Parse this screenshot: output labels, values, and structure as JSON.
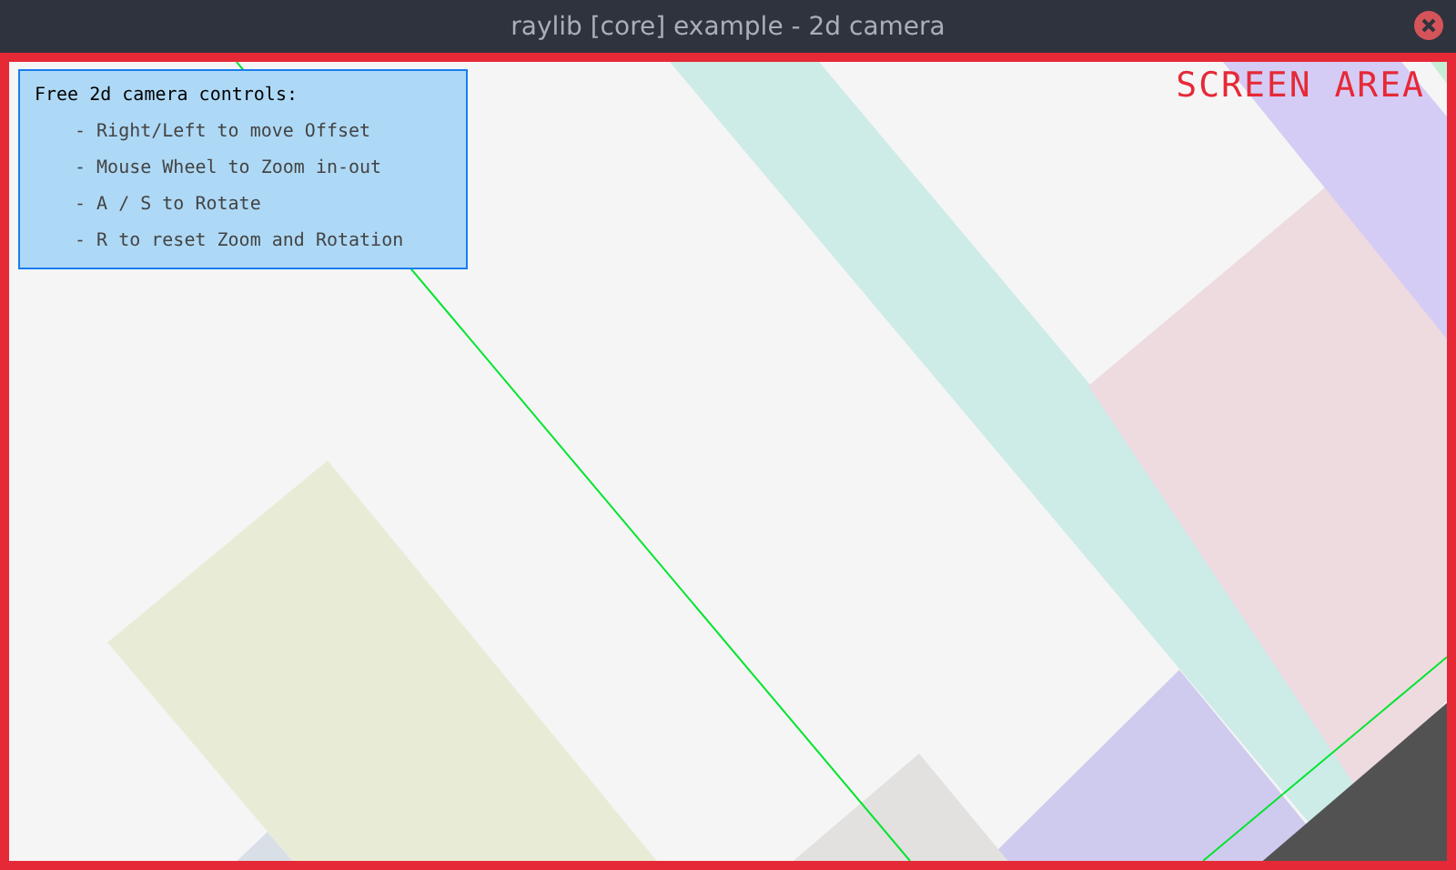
{
  "window": {
    "title": "raylib [core] example - 2d camera"
  },
  "screen_label": "SCREEN AREA",
  "info_panel": {
    "title": "Free 2d camera controls:",
    "items": [
      "- Right/Left to move Offset",
      "- Mouse Wheel to Zoom in-out",
      "- A / S to Rotate",
      "- R to reset Zoom and Rotation"
    ]
  }
}
